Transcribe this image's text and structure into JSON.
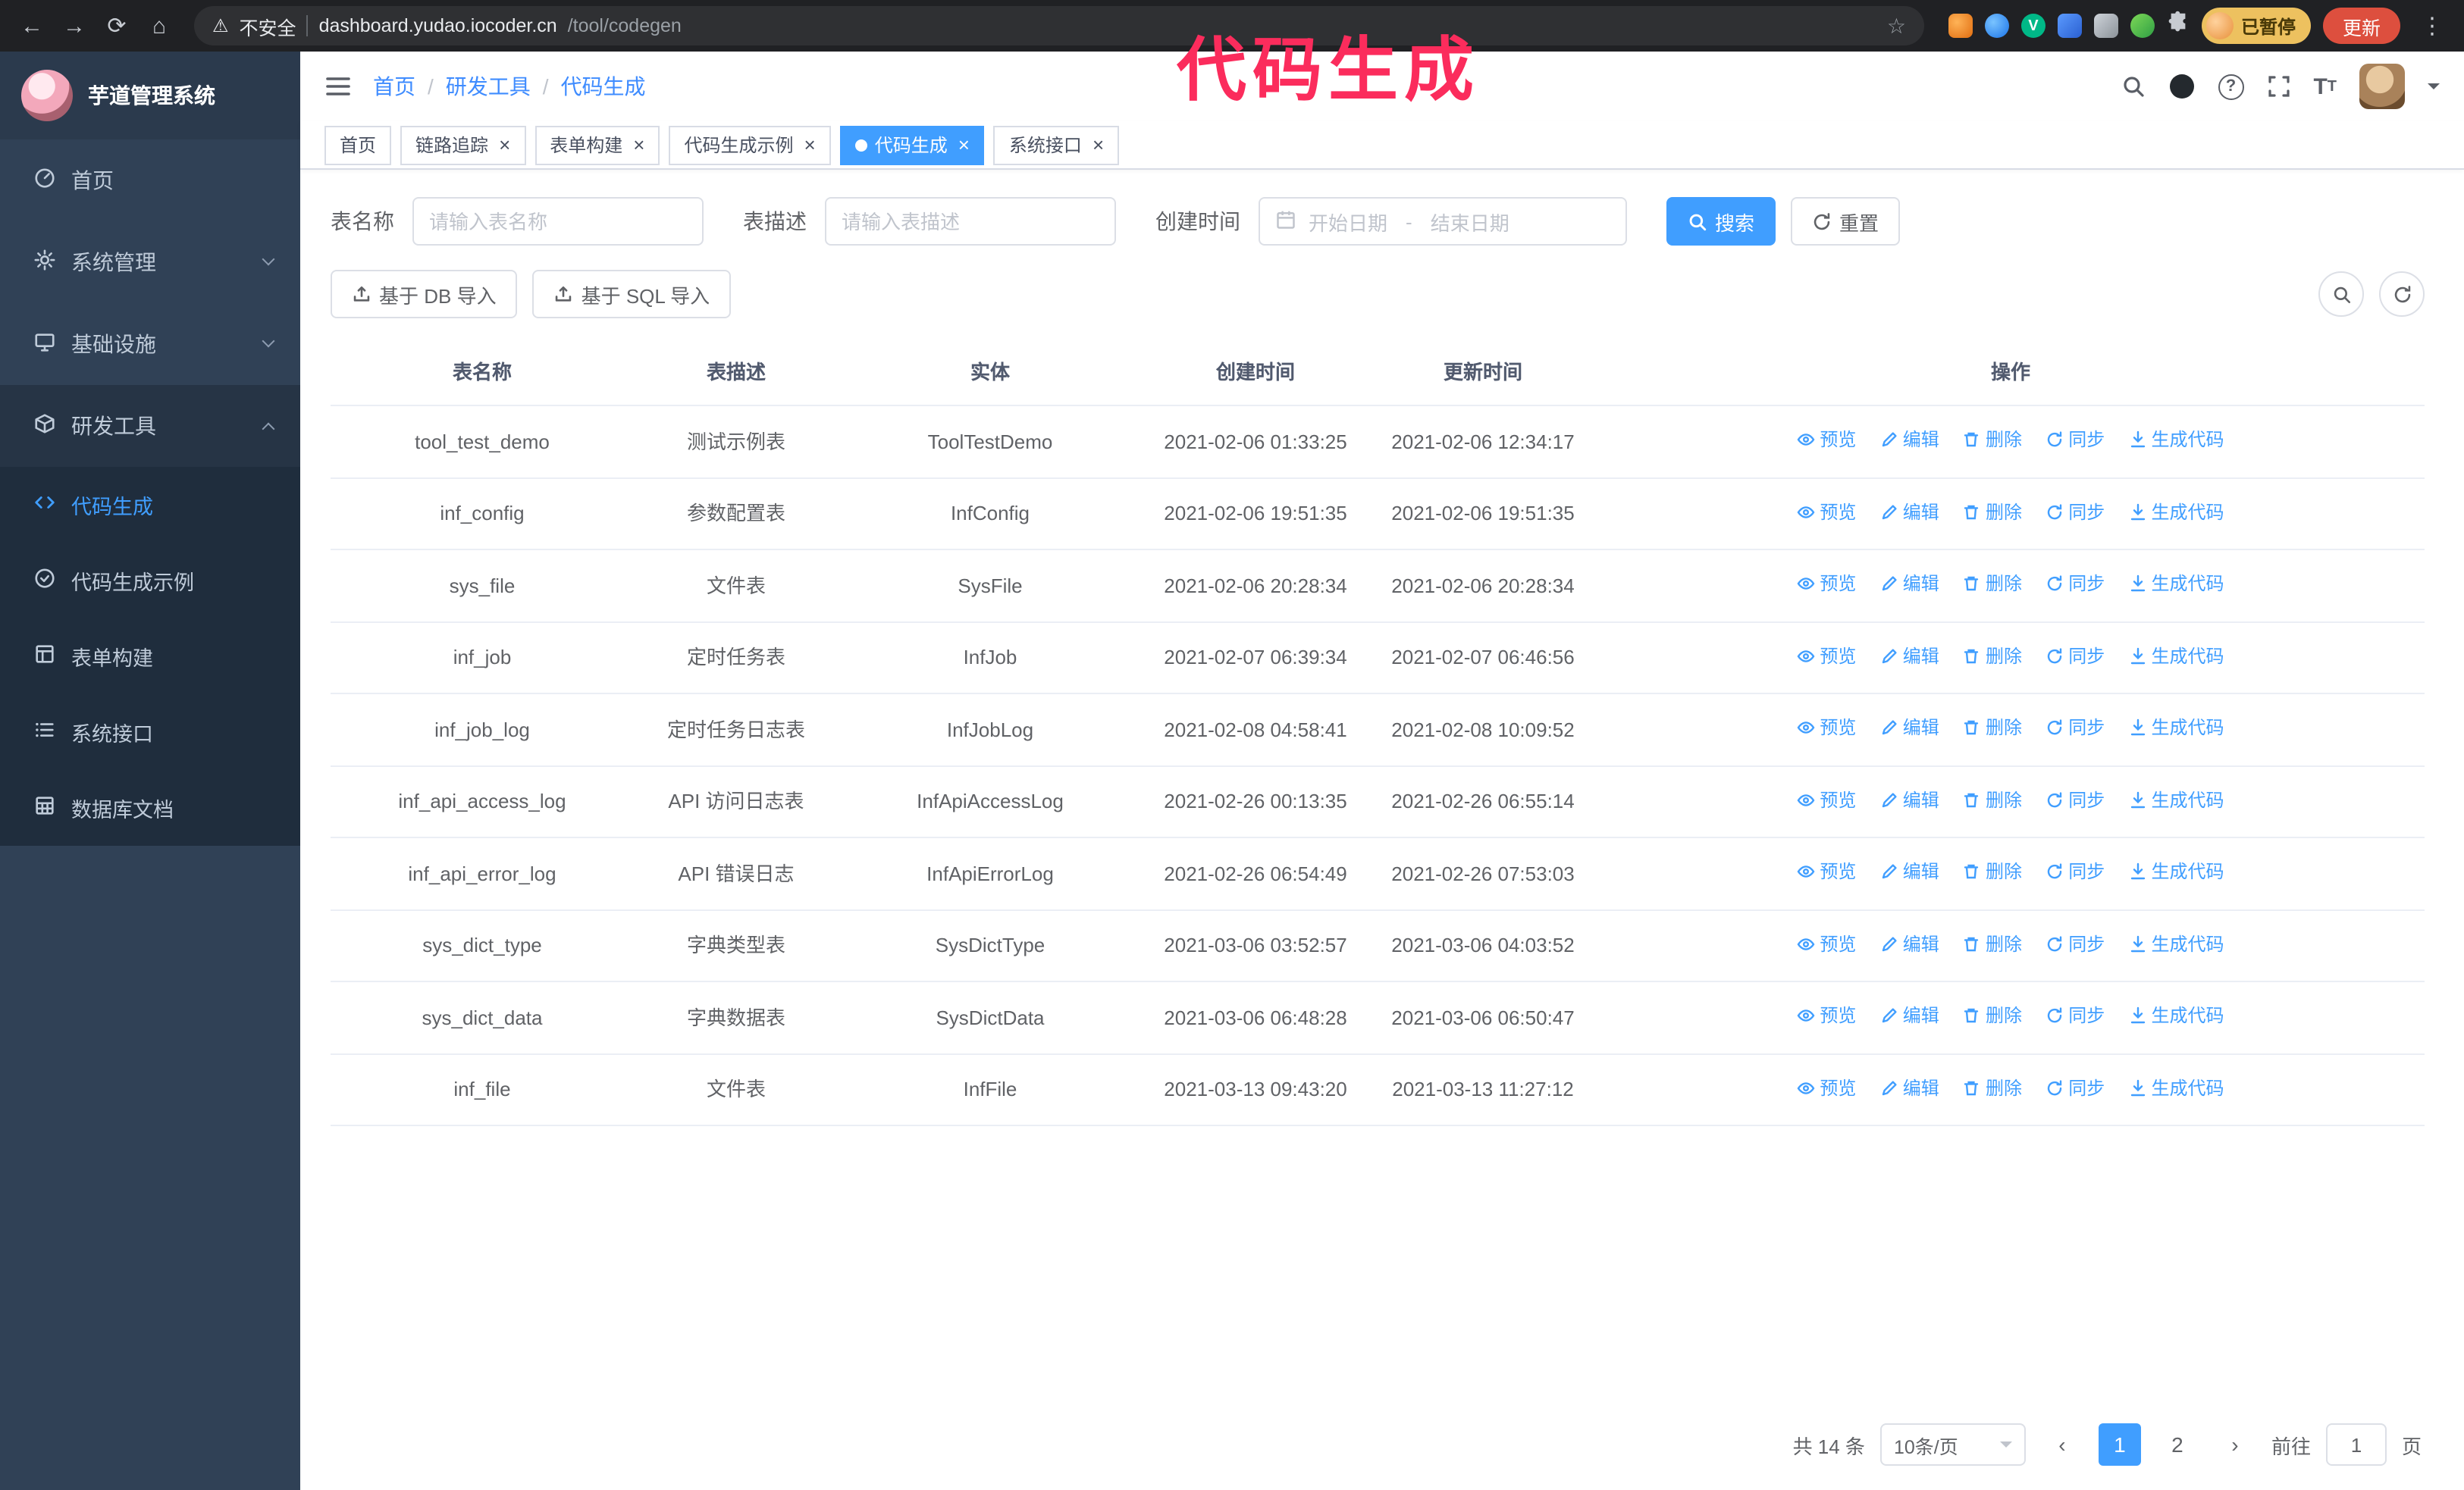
{
  "annotation": {
    "text": "代码生成",
    "color": "#fb2c5c"
  },
  "colors": {
    "accent": "#409eff",
    "sidebar_bg": "#304156",
    "submenu_bg": "#1f2d3d",
    "browser_bg": "#202124",
    "danger": "#dd4f3e"
  },
  "icons": {
    "back": "←",
    "forward": "→",
    "reload": "⟳",
    "home": "⌂",
    "warning": "⚠",
    "star": "☆",
    "menu_kebab": "⋮",
    "tag_close": "×",
    "prev": "‹",
    "next": "›",
    "question": "?",
    "fontsize_large": "T",
    "fontsize_small": "T",
    "ext_v": "V"
  },
  "browser": {
    "not_secure_label": "不安全",
    "url_host": "dashboard.yudao.iocoder.cn",
    "url_path": "/tool/codegen",
    "paused_badge": "已暂停",
    "update_button": "更新"
  },
  "sidebar": {
    "logo_title": "芋道管理系统",
    "items": [
      {
        "label": "首页"
      },
      {
        "label": "系统管理"
      },
      {
        "label": "基础设施"
      },
      {
        "label": "研发工具"
      }
    ],
    "subitems": [
      {
        "label": "代码生成",
        "active": true
      },
      {
        "label": "代码生成示例"
      },
      {
        "label": "表单构建"
      },
      {
        "label": "系统接口"
      },
      {
        "label": "数据库文档"
      }
    ]
  },
  "header": {
    "breadcrumb": [
      "首页",
      "研发工具",
      "代码生成"
    ]
  },
  "tags": [
    {
      "label": "首页",
      "closable": false,
      "active": false
    },
    {
      "label": "链路追踪",
      "closable": true,
      "active": false
    },
    {
      "label": "表单构建",
      "closable": true,
      "active": false
    },
    {
      "label": "代码生成示例",
      "closable": true,
      "active": false
    },
    {
      "label": "代码生成",
      "closable": true,
      "active": true
    },
    {
      "label": "系统接口",
      "closable": true,
      "active": false
    }
  ],
  "filters": {
    "table_name_label": "表名称",
    "table_name_placeholder": "请输入表名称",
    "table_desc_label": "表描述",
    "table_desc_placeholder": "请输入表描述",
    "create_time_label": "创建时间",
    "date_start_placeholder": "开始日期",
    "date_separator": "-",
    "date_end_placeholder": "结束日期",
    "search_button": "搜索",
    "reset_button": "重置"
  },
  "toolbar": {
    "import_db_button": "基于 DB 导入",
    "import_sql_button": "基于 SQL 导入"
  },
  "table": {
    "columns": [
      "表名称",
      "表描述",
      "实体",
      "创建时间",
      "更新时间",
      "操作"
    ],
    "ops": [
      "预览",
      "编辑",
      "删除",
      "同步",
      "生成代码"
    ],
    "rows": [
      {
        "name": "tool_test_demo",
        "desc": "测试示例表",
        "entity": "ToolTestDemo",
        "created": "2021-02-06 01:33:25",
        "updated": "2021-02-06 12:34:17"
      },
      {
        "name": "inf_config",
        "desc": "参数配置表",
        "entity": "InfConfig",
        "created": "2021-02-06 19:51:35",
        "updated": "2021-02-06 19:51:35"
      },
      {
        "name": "sys_file",
        "desc": "文件表",
        "entity": "SysFile",
        "created": "2021-02-06 20:28:34",
        "updated": "2021-02-06 20:28:34"
      },
      {
        "name": "inf_job",
        "desc": "定时任务表",
        "entity": "InfJob",
        "created": "2021-02-07 06:39:34",
        "updated": "2021-02-07 06:46:56"
      },
      {
        "name": "inf_job_log",
        "desc": "定时任务日志表",
        "entity": "InfJobLog",
        "created": "2021-02-08 04:58:41",
        "updated": "2021-02-08 10:09:52"
      },
      {
        "name": "inf_api_access_log",
        "desc": "API 访问日志表",
        "entity": "InfApiAccessLog",
        "created": "2021-02-26 00:13:35",
        "updated": "2021-02-26 06:55:14"
      },
      {
        "name": "inf_api_error_log",
        "desc": "API 错误日志",
        "entity": "InfApiErrorLog",
        "created": "2021-02-26 06:54:49",
        "updated": "2021-02-26 07:53:03"
      },
      {
        "name": "sys_dict_type",
        "desc": "字典类型表",
        "entity": "SysDictType",
        "created": "2021-03-06 03:52:57",
        "updated": "2021-03-06 04:03:52"
      },
      {
        "name": "sys_dict_data",
        "desc": "字典数据表",
        "entity": "SysDictData",
        "created": "2021-03-06 06:48:28",
        "updated": "2021-03-06 06:50:47"
      },
      {
        "name": "inf_file",
        "desc": "文件表",
        "entity": "InfFile",
        "created": "2021-03-13 09:43:20",
        "updated": "2021-03-13 11:27:12"
      }
    ]
  },
  "pagination": {
    "total": "共 14 条",
    "page_size": "10条/页",
    "pages": [
      {
        "label": "1",
        "active": true
      },
      {
        "label": "2",
        "active": false
      }
    ],
    "goto_label": "前往",
    "goto_value": "1",
    "goto_suffix": "页"
  }
}
